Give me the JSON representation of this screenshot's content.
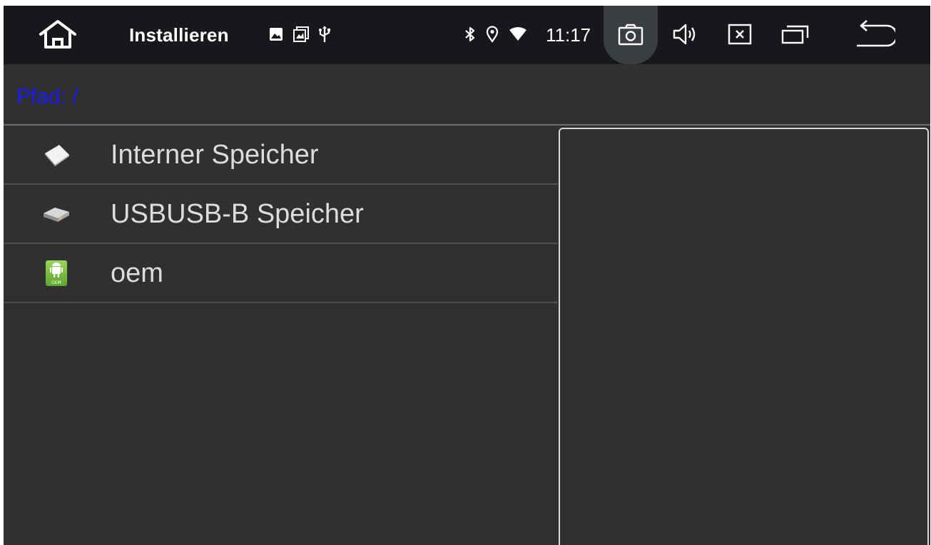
{
  "statusbar": {
    "app_title": "Installieren",
    "time": "11:17",
    "home_icon": "home-icon",
    "notification_icons": [
      "image-icon",
      "gallery-icon",
      "usb-icon"
    ],
    "system_icons": [
      "bluetooth-icon",
      "location-icon",
      "wifi-icon"
    ],
    "nav_buttons": [
      "camera-icon",
      "volume-icon",
      "close-icon",
      "recents-icon",
      "back-icon"
    ]
  },
  "path": {
    "label": "Pfad:",
    "value": "/",
    "text": "Pfad: /",
    "color": "#1a1aff"
  },
  "files": [
    {
      "label": "Interner Speicher",
      "icon": "internal-storage-icon"
    },
    {
      "label": "USBUSB-B Speicher",
      "icon": "usb-drive-icon"
    },
    {
      "label": "oem",
      "icon": "android-oem-icon",
      "icon_text": "OEM"
    }
  ],
  "colors": {
    "statusbar_bg": "#16181c",
    "screen_bg": "#303030",
    "text": "#dcdcdc",
    "accent_path": "#1a1aff",
    "oem_green": "#7cc243"
  }
}
